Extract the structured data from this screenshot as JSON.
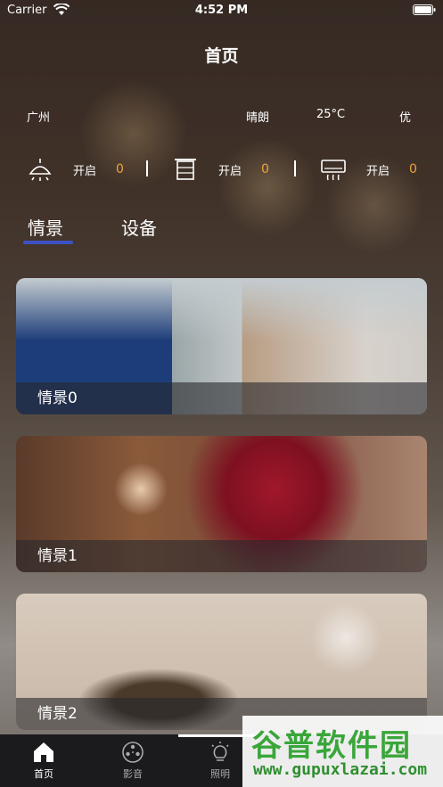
{
  "status_bar": {
    "carrier": "Carrier",
    "time": "4:52 PM"
  },
  "header": {
    "title": "首页"
  },
  "info": {
    "city": "广州",
    "weather": "晴朗",
    "temperature": "25°C",
    "air_quality": "优"
  },
  "devices": [
    {
      "icon": "ceiling-lamp-icon",
      "label": "开启",
      "count": "0"
    },
    {
      "icon": "curtain-icon",
      "label": "开启",
      "count": "0"
    },
    {
      "icon": "air-conditioner-icon",
      "label": "开启",
      "count": "0"
    }
  ],
  "tabs": [
    {
      "label": "情景"
    },
    {
      "label": "设备"
    }
  ],
  "scenes": [
    {
      "label": "情景0"
    },
    {
      "label": "情景1"
    },
    {
      "label": "情景2"
    }
  ],
  "tabbar": [
    {
      "icon": "home-icon",
      "label": "首页"
    },
    {
      "icon": "film-reel-icon",
      "label": "影音"
    },
    {
      "icon": "light-bulb-icon",
      "label": "照明"
    }
  ],
  "watermark": {
    "line1": "谷普软件园",
    "line2": "www.gupuxlazai.com"
  },
  "colors": {
    "accent": "#3c52c4",
    "count": "#f0a340",
    "tabbar": "#1b1b1d"
  }
}
